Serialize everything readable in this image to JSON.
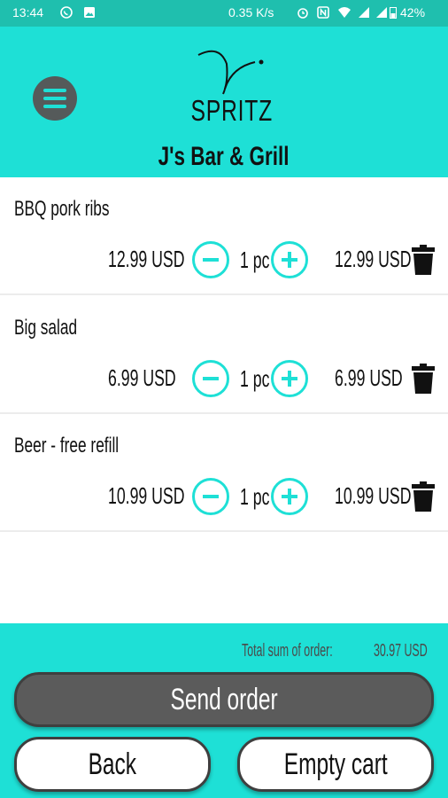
{
  "status_bar": {
    "time": "13:44",
    "network_speed": "0.35 K/s",
    "battery": "42%",
    "icons": [
      "whatsapp-icon",
      "image-icon",
      "alarm-icon",
      "nfc-icon",
      "wifi-icon",
      "signal-icon",
      "signal-icon",
      "battery-icon"
    ]
  },
  "header": {
    "logo_text": "SPRITZ",
    "venue_name": "J's Bar & Grill"
  },
  "cart": {
    "items": [
      {
        "name": "BBQ pork ribs",
        "unit_price": "12.99 USD",
        "quantity": "1 pc",
        "line_total": "12.99 USD"
      },
      {
        "name": "Big salad",
        "unit_price": "6.99 USD",
        "quantity": "1 pc",
        "line_total": "6.99 USD"
      },
      {
        "name": "Beer - free refill",
        "unit_price": "10.99 USD",
        "quantity": "1 pc",
        "line_total": "10.99 USD"
      }
    ]
  },
  "footer": {
    "total_label": "Total sum of order:",
    "total_value": "30.97 USD",
    "send_label": "Send order",
    "back_label": "Back",
    "empty_label": "Empty cart"
  },
  "colors": {
    "accent": "#1ee0d6",
    "status_bar": "#1fbfae",
    "dark_button": "#5b5b5b"
  }
}
